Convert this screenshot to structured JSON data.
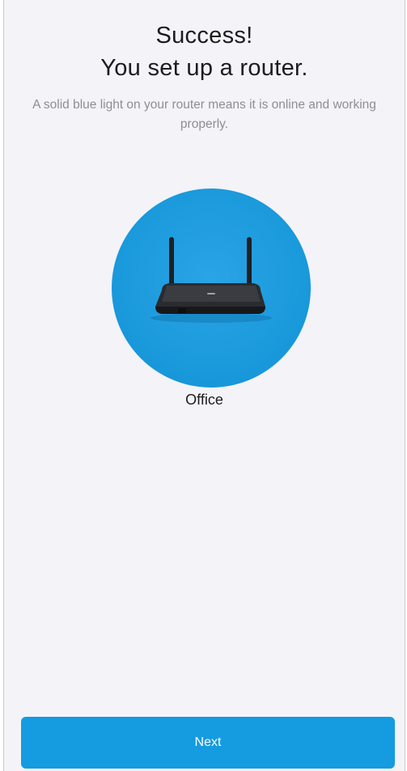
{
  "header": {
    "title_line1": "Success!",
    "title_line2": "You set up a router.",
    "description": "A solid blue light on your router means it is online and working properly."
  },
  "device": {
    "name": "Office",
    "icon": "router-icon",
    "circle_color": "#1a9ddf"
  },
  "footer": {
    "next_label": "Next",
    "button_color": "#159be0"
  }
}
